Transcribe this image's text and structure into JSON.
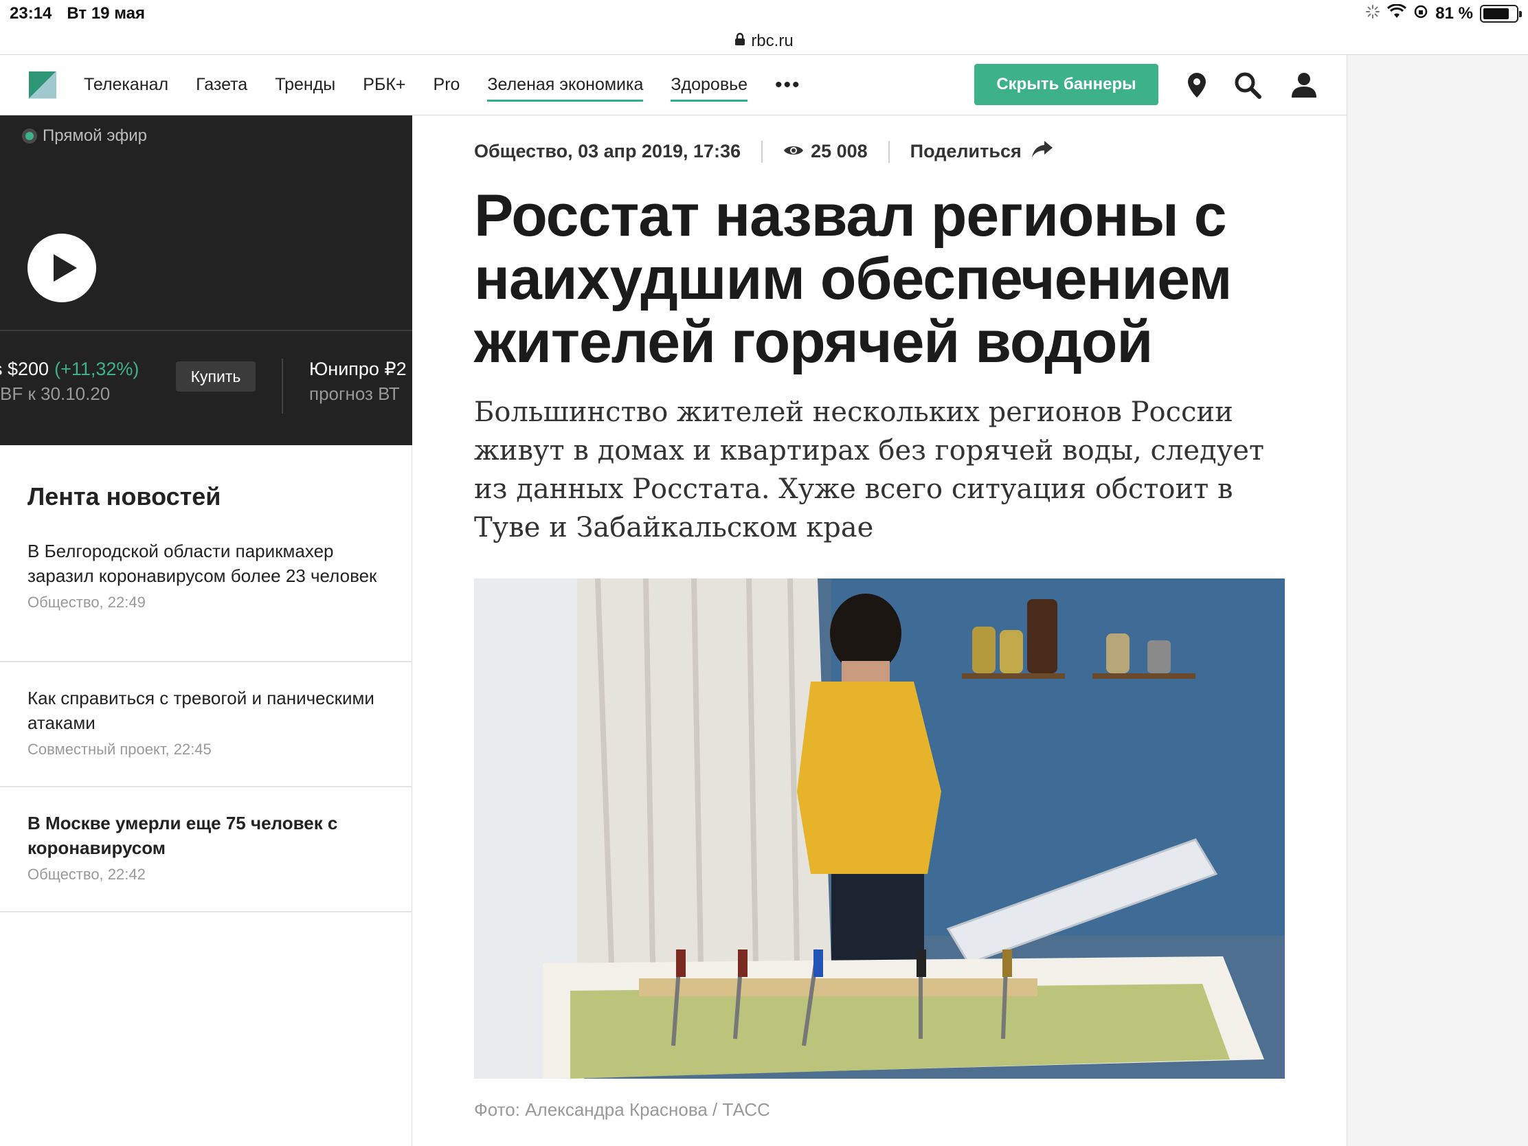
{
  "status": {
    "time": "23:14",
    "date": "Вт 19 мая",
    "battery": "81 %",
    "battery_level": 0.81
  },
  "browser": {
    "url": "rbc.ru"
  },
  "header": {
    "nav": [
      "Телеканал",
      "Газета",
      "Тренды",
      "РБК+",
      "Pro",
      "Зеленая экономика",
      "Здоровье"
    ],
    "more": "•••",
    "hide_banners": "Скрыть баннеры"
  },
  "live": {
    "label": "Прямой эфир"
  },
  "ticker": {
    "item1_line1": "s $200",
    "item1_change": "(+11,32%)",
    "item1_line2": "BF к 30.10.20",
    "buy": "Купить",
    "item2_line1": "Юнипро ₽2",
    "item2_line2": "прогноз ВТ"
  },
  "feed": {
    "title": "Лента новостей",
    "items": [
      {
        "title": "В Белгородской области парикмахер заразил коронавирусом более 23 человек",
        "meta": "Общество, 22:49"
      },
      {
        "title": "Как справиться с тревогой и паническими атаками",
        "meta": "Совместный проект, 22:45"
      },
      {
        "title": "В Москве умерли еще 75 человек с коронавирусом",
        "meta": "Общество, 22:42"
      }
    ]
  },
  "article": {
    "meta": "Общество, 03 апр 2019, 17:36",
    "views": "25 008",
    "share": "Поделиться",
    "headline": "Росстат назвал регионы с наихудшим обеспечением жителей горячей водой",
    "lead": "Большинство жителей нескольких регионов России живут в домах и квартирах без горячей воды, следует из данных Росстата. Хуже всего ситуация обстоит в Туве и Забайкальском крае",
    "caption": "Фото: Александра Краснова / ТАСС"
  }
}
